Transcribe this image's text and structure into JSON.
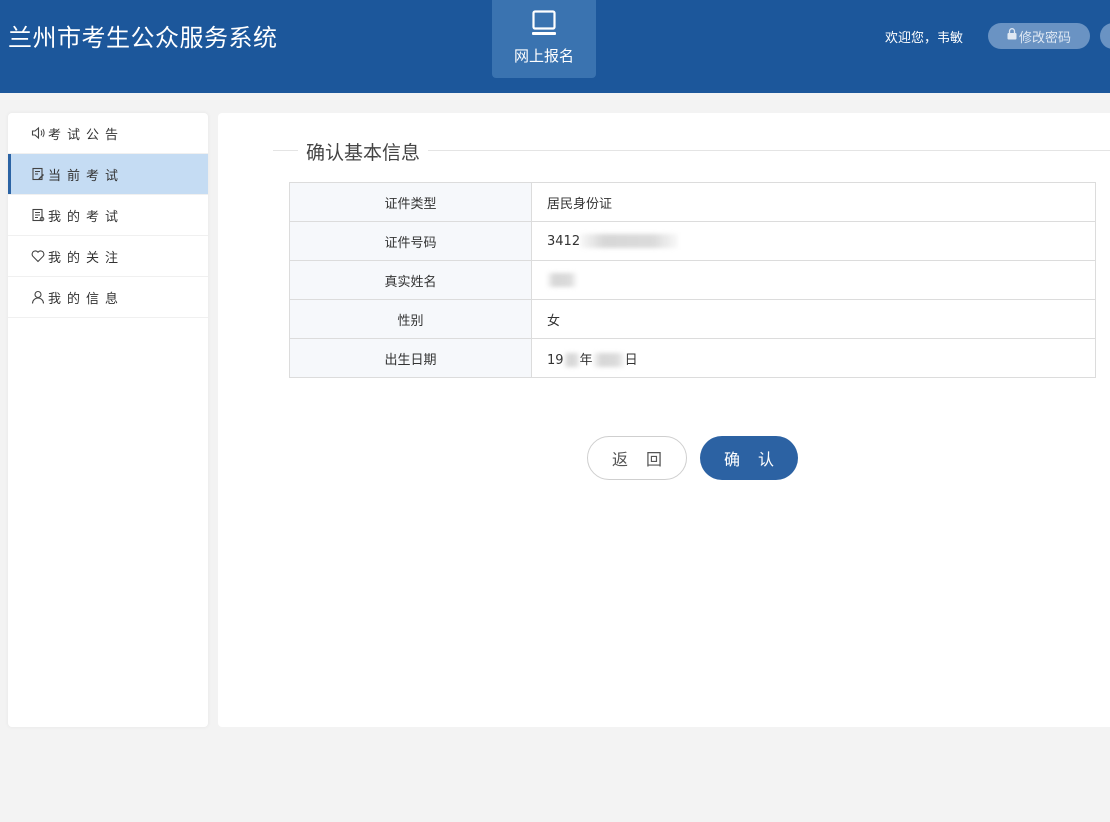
{
  "header": {
    "app_title": "兰州市考生公众服务系统",
    "nav_tile": {
      "label": "网上报名",
      "icon": "laptop-icon"
    },
    "welcome_text": "欢迎您，韦敏",
    "change_password_label": "修改密码"
  },
  "sidebar": {
    "items": [
      {
        "label": "考试公告",
        "icon": "speaker-icon",
        "active": false
      },
      {
        "label": "当前考试",
        "icon": "edit-document-icon",
        "active": true
      },
      {
        "label": "我的考试",
        "icon": "document-icon",
        "active": false
      },
      {
        "label": "我的关注",
        "icon": "heart-icon",
        "active": false
      },
      {
        "label": "我的信息",
        "icon": "user-icon",
        "active": false
      }
    ]
  },
  "main": {
    "section_title": "确认基本信息",
    "rows": [
      {
        "label": "证件类型",
        "value": "居民身份证"
      },
      {
        "label": "证件号码",
        "value": "3412"
      },
      {
        "label": "真实姓名",
        "value": ""
      },
      {
        "label": "性别",
        "value": "女"
      },
      {
        "label": "出生日期",
        "value_prefix": "19",
        "value_mid": "年",
        "value_suffix": "日"
      }
    ],
    "back_button": "返回",
    "confirm_button": "确认"
  },
  "colors": {
    "header_bg": "#1c579b",
    "accent": "#2c62a3",
    "active_item_bg": "#c5dcf3"
  }
}
